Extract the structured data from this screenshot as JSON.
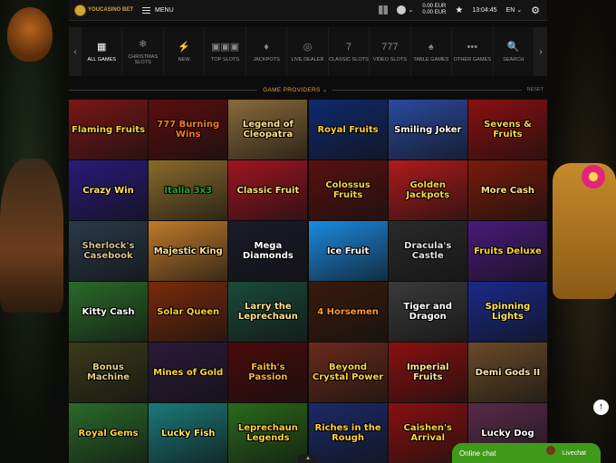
{
  "header": {
    "logo_text": "YOUCASINO BET",
    "menu_label": "MENU",
    "balance_main": "0.00 EUR",
    "balance_bonus": "0.00 EUR",
    "time": "13:04:45",
    "language": "EN"
  },
  "categories": [
    {
      "label": "ALL GAMES",
      "icon": "▦"
    },
    {
      "label": "CHRISTMAS SLOTS",
      "icon": "❄"
    },
    {
      "label": "NEW",
      "icon": "⚡"
    },
    {
      "label": "TOP SLOTS",
      "icon": "▣▣▣"
    },
    {
      "label": "JACKPOTS",
      "icon": "♦"
    },
    {
      "label": "LIVE DEALER",
      "icon": "◎"
    },
    {
      "label": "CLASSIC SLOTS",
      "icon": "7"
    },
    {
      "label": "VIDEO SLOTS",
      "icon": "777"
    },
    {
      "label": "TABLE GAMES",
      "icon": "♠"
    },
    {
      "label": "OTHER GAMES",
      "icon": "•••"
    },
    {
      "label": "SEARCH",
      "icon": "🔍"
    }
  ],
  "providers": {
    "label": "GAME PROVIDERS",
    "reset": "RESET"
  },
  "games": [
    {
      "title": "Flaming Fruits",
      "bg": "#7a1616",
      "fg": "#ffd23a"
    },
    {
      "title": "777 Burning Wins",
      "bg": "#5a0e0e",
      "fg": "#ff7a1a"
    },
    {
      "title": "Legend of Cleopatra",
      "bg": "#8a6a3a",
      "fg": "#ffe08a"
    },
    {
      "title": "Royal Fruits",
      "bg": "#0e2a6e",
      "fg": "#ffcc33"
    },
    {
      "title": "Smiling Joker",
      "bg": "#2a4aa0",
      "fg": "#ffffff"
    },
    {
      "title": "Sevens & Fruits",
      "bg": "#8a1010",
      "fg": "#ffd23a"
    },
    {
      "title": "Crazy Win",
      "bg": "#2a1a7a",
      "fg": "#ffe45a"
    },
    {
      "title": "Italia 3x3",
      "bg": "#8a6a2a",
      "fg": "#2aa040"
    },
    {
      "title": "Classic Fruit",
      "bg": "#a01420",
      "fg": "#ffe06a"
    },
    {
      "title": "Colossus Fruits",
      "bg": "#5a1010",
      "fg": "#ffd23a"
    },
    {
      "title": "Golden Jackpots",
      "bg": "#b01a1a",
      "fg": "#ffd23a"
    },
    {
      "title": "More Cash",
      "bg": "#7a1a0a",
      "fg": "#ffe08a"
    },
    {
      "title": "Sherlock's Casebook",
      "bg": "#2a3a4a",
      "fg": "#d6c08a"
    },
    {
      "title": "Majestic King",
      "bg": "#c07a2a",
      "fg": "#ffe08a"
    },
    {
      "title": "Mega Diamonds",
      "bg": "#1a1a2a",
      "fg": "#ffffff"
    },
    {
      "title": "Ice Fruit",
      "bg": "#1a8ae0",
      "fg": "#ffffff"
    },
    {
      "title": "Dracula's Castle",
      "bg": "#2a2a2a",
      "fg": "#e0e0e0"
    },
    {
      "title": "Fruits Deluxe",
      "bg": "#4a1a7a",
      "fg": "#ffd23a"
    },
    {
      "title": "Kitty Cash",
      "bg": "#2a6a2a",
      "fg": "#ffffff"
    },
    {
      "title": "Solar Queen",
      "bg": "#7a2a0a",
      "fg": "#ffcc33"
    },
    {
      "title": "Larry the Leprechaun",
      "bg": "#1a4a3a",
      "fg": "#ffe08a"
    },
    {
      "title": "4 Horsemen",
      "bg": "#3a1a0a",
      "fg": "#ff9a2a"
    },
    {
      "title": "Tiger and Dragon",
      "bg": "#3a3a3a",
      "fg": "#ffffff"
    },
    {
      "title": "Spinning Lights",
      "bg": "#1a2a8a",
      "fg": "#ffe45a"
    },
    {
      "title": "Bonus Machine",
      "bg": "#3a3a1a",
      "fg": "#e0d07a"
    },
    {
      "title": "Mines of Gold",
      "bg": "#2a1a3a",
      "fg": "#ffd23a"
    },
    {
      "title": "Faith's Passion",
      "bg": "#4a0a0a",
      "fg": "#ffb03a"
    },
    {
      "title": "Beyond Crystal Power",
      "bg": "#6a2a1a",
      "fg": "#ffd23a"
    },
    {
      "title": "Imperial Fruits",
      "bg": "#8a1010",
      "fg": "#ffe08a"
    },
    {
      "title": "Demi Gods II",
      "bg": "#6a4a2a",
      "fg": "#ffe6b0"
    },
    {
      "title": "Royal Gems",
      "bg": "#2a6a2a",
      "fg": "#ffd23a"
    },
    {
      "title": "Lucky Fish",
      "bg": "#1a7a7a",
      "fg": "#ffe45a"
    },
    {
      "title": "Leprechaun Legends",
      "bg": "#2a6a1a",
      "fg": "#ffd23a"
    },
    {
      "title": "Riches in the Rough",
      "bg": "#1a2a6a",
      "fg": "#ffd23a"
    },
    {
      "title": "Caishen's Arrival",
      "bg": "#8a1010",
      "fg": "#ffd23a"
    },
    {
      "title": "Lucky Dog",
      "bg": "#5a2a4a",
      "fg": "#ffffff"
    }
  ],
  "chat": {
    "label": "Online chat",
    "label2": "Livechat"
  },
  "colors": {
    "accent": "#d4a536",
    "chat": "#3f9a1a"
  }
}
